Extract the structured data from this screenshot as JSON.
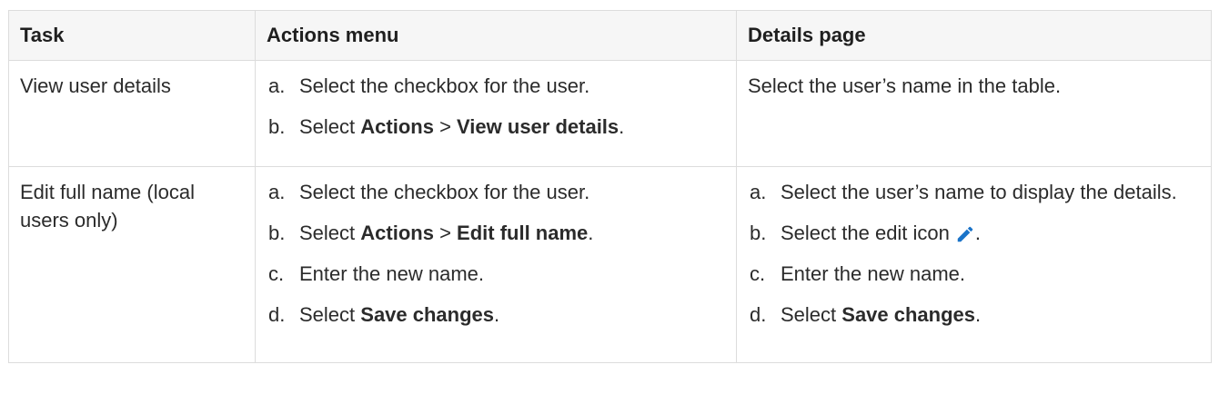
{
  "headers": {
    "task": "Task",
    "actions": "Actions menu",
    "details": "Details page"
  },
  "rows": [
    {
      "task": "View user details",
      "actions": [
        {
          "letter": "a.",
          "pre": "Select the checkbox for the user."
        },
        {
          "letter": "b.",
          "pre": "Select ",
          "bold1": "Actions",
          "mid": " > ",
          "bold2": "View user details",
          "post": "."
        }
      ],
      "details_text": "Select the user’s name in the table."
    },
    {
      "task": "Edit full name (local users only)",
      "actions": [
        {
          "letter": "a.",
          "pre": "Select the checkbox for the user."
        },
        {
          "letter": "b.",
          "pre": "Select ",
          "bold1": "Actions",
          "mid": " > ",
          "bold2": "Edit full name",
          "post": "."
        },
        {
          "letter": "c.",
          "pre": "Enter the new name."
        },
        {
          "letter": "d.",
          "pre": "Select ",
          "bold1": "Save changes",
          "post": "."
        }
      ],
      "details": [
        {
          "letter": "a.",
          "pre": "Select the user’s name to display the details."
        },
        {
          "letter": "b.",
          "pre": "Select the edit icon",
          "post": "."
        },
        {
          "letter": "c.",
          "pre": "Enter the new name."
        },
        {
          "letter": "d.",
          "pre": "Select ",
          "bold1": "Save changes",
          "post": "."
        }
      ]
    }
  ],
  "icon": {
    "name": "pencil-edit-icon",
    "color": "#1a73c8"
  }
}
